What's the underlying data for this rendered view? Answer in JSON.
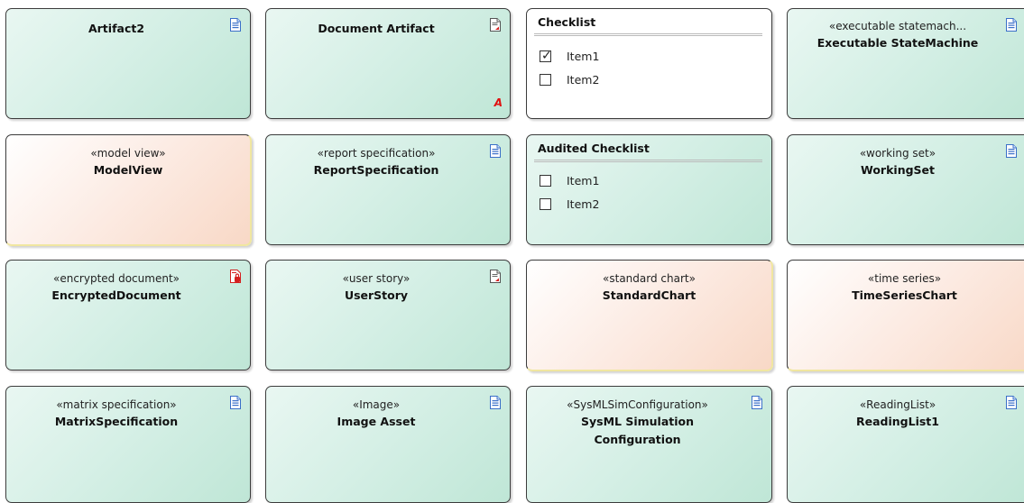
{
  "elements": {
    "artifact2": {
      "name": "Artifact2",
      "icon": "document-icon"
    },
    "document_artifact": {
      "name": "Document Artifact",
      "icon": "linked-document-icon",
      "marker": "A"
    },
    "checklist": {
      "title": "Checklist",
      "items": [
        {
          "label": "Item1",
          "checked": true,
          "mark": "✓"
        },
        {
          "label": "Item2",
          "checked": false
        }
      ]
    },
    "executable_statemachine": {
      "stereotype": "«executable statemach...",
      "name": "Executable StateMachine",
      "icon": "document-icon"
    },
    "modelview": {
      "stereotype": "«model view»",
      "name": "ModelView"
    },
    "reportspecification": {
      "stereotype": "«report specification»",
      "name": "ReportSpecification",
      "icon": "document-icon"
    },
    "audited_checklist": {
      "title": "Audited Checklist",
      "items": [
        {
          "label": "Item1",
          "checked": false
        },
        {
          "label": "Item2",
          "checked": false
        }
      ]
    },
    "workingset": {
      "stereotype": "«working set»",
      "name": "WorkingSet",
      "icon": "document-icon"
    },
    "encrypteddocument": {
      "stereotype": "«encrypted document»",
      "name": "EncryptedDocument",
      "icon": "encrypted-document-icon"
    },
    "userstory": {
      "stereotype": "«user story»",
      "name": "UserStory",
      "icon": "linked-document-icon"
    },
    "standardchart": {
      "stereotype": "«standard chart»",
      "name": "StandardChart"
    },
    "timeserieschart": {
      "stereotype": "«time series»",
      "name": "TimeSeriesChart"
    },
    "matrixspecification": {
      "stereotype": "«matrix specification»",
      "name": "MatrixSpecification",
      "icon": "document-icon"
    },
    "image_asset": {
      "stereotype": "«Image»",
      "name": "Image Asset",
      "icon": "document-icon"
    },
    "sysml_sim_config": {
      "stereotype": "«SysMLSimConfiguration»",
      "name_line1": "SysML Simulation",
      "name_line2": "Configuration",
      "icon": "document-icon"
    },
    "readinglist1": {
      "stereotype": "«ReadingList»",
      "name": "ReadingList1",
      "icon": "document-icon"
    }
  },
  "colors": {
    "teal_fill": "#cfeee1",
    "peach_fill": "#f9dccc",
    "border": "#3c3c3c",
    "icon_blue": "#3a6fc8",
    "icon_red": "#d42020",
    "marker_red": "#e01010"
  }
}
